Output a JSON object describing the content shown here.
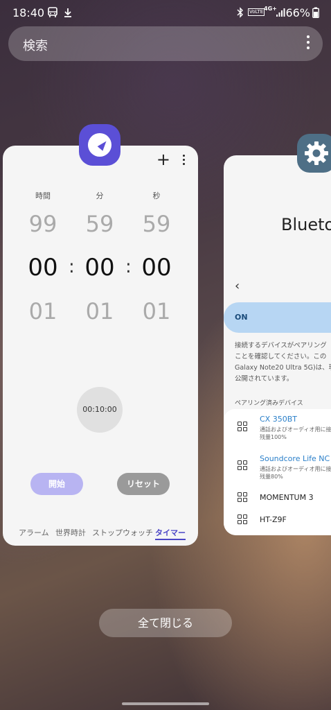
{
  "status_bar": {
    "time": "18:40",
    "battery_text": "66%",
    "network_label": "4G+",
    "volte_label": "VoLTE"
  },
  "search": {
    "placeholder": "検索"
  },
  "clock_card": {
    "columns": {
      "hours_label": "時間",
      "minutes_label": "分",
      "seconds_label": "秒"
    },
    "prev_row": {
      "hours": "99",
      "minutes": "59",
      "seconds": "59"
    },
    "current_row": {
      "hours": "00",
      "minutes": "00",
      "seconds": "00"
    },
    "next_row": {
      "hours": "01",
      "minutes": "01",
      "seconds": "01"
    },
    "separator": ":",
    "preset": "00:10:00",
    "start_label": "開始",
    "reset_label": "リセット",
    "tabs": [
      "アラーム",
      "世界時計",
      "ストップウォッチ",
      "タイマー"
    ],
    "active_tab": "タイマー"
  },
  "settings_card": {
    "title": "Bluetoo",
    "toggle_label": "ON",
    "description_lines": [
      "接続するデバイスがペアリング",
      "ことを確認してください。この",
      "Galaxy Note20 Ultra 5G)は、現",
      "公開されています。"
    ],
    "section_label": "ペアリング済みデバイス",
    "devices": [
      {
        "name": "CX 350BT",
        "detail_1": "通話およびオーディオ用に接",
        "detail_2": "残量100%"
      },
      {
        "name": "Soundcore Life NC",
        "detail_1": "通話およびオーディオ用に接",
        "detail_2": "残量80%"
      },
      {
        "name": "MOMENTUM 3"
      },
      {
        "name": "HT-Z9F"
      }
    ]
  },
  "close_all_label": "全て閉じる",
  "colors": {
    "clock_accent": "#5b4fd6",
    "settings_accent": "#4e6f86",
    "bt_blue": "#2a7fc9"
  }
}
